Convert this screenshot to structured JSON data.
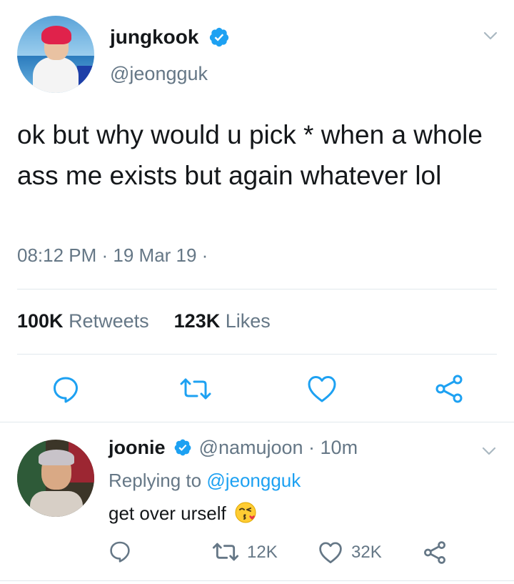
{
  "main_tweet": {
    "display_name": "jungkook",
    "handle": "@jeongguk",
    "text": "ok but why would u pick * when a whole ass me exists but again whatever lol",
    "timestamp": "08:12 PM · 19 Mar 19 ·",
    "retweets_count": "100K",
    "retweets_label": "Retweets",
    "likes_count": "123K",
    "likes_label": "Likes"
  },
  "reply_tweet": {
    "display_name": "joonie",
    "handle": "@namujoon",
    "time": "· 10m",
    "replying_prefix": "Replying to",
    "replying_mention": "@jeongguk",
    "text": "get over urself",
    "retweet_count": "12K",
    "like_count": "32K"
  },
  "colors": {
    "verified": "#1da1f2",
    "secondary_text": "#657786",
    "icon": "#1da1f2",
    "divider": "#e1e8ed"
  },
  "icons": [
    "verified-badge-icon",
    "chevron-down-icon",
    "reply-icon",
    "retweet-icon",
    "like-icon",
    "share-icon",
    "kissing-face-emoji"
  ]
}
